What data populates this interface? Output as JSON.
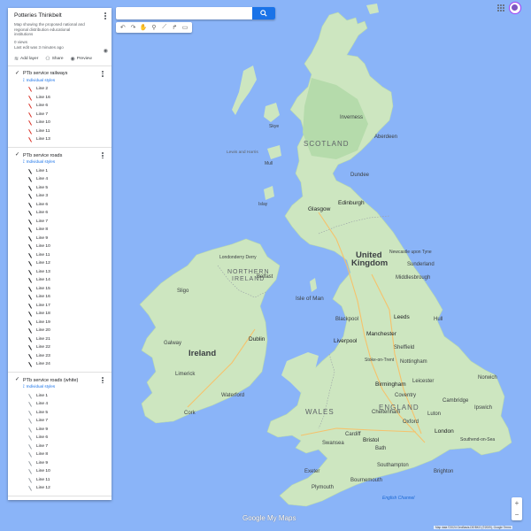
{
  "search": {
    "placeholder": "",
    "value": ""
  },
  "toolbar": {
    "icons": [
      "undo-icon",
      "redo-icon",
      "hand-icon",
      "marker-icon",
      "draw-line-icon",
      "directions-icon",
      "ruler-icon"
    ]
  },
  "panel": {
    "title": "Potteries Thinkbelt",
    "description": "Map showing the proposed national and regional distribution educational institutions",
    "views": "0 views",
    "last_edit": "Last edit was 3 minutes ago",
    "actions": {
      "add_layer": "Add layer",
      "share": "Share",
      "preview": "Preview"
    },
    "individual_styles": "Individual styles",
    "layers": [
      {
        "name": "PTb service railways",
        "color": "#d93025",
        "items": [
          "Line 2",
          "Line 16",
          "Line 6",
          "Line 7",
          "Line 10",
          "Line 11",
          "Line 13"
        ]
      },
      {
        "name": "PTb service roads",
        "color": "#202124",
        "items": [
          "Line 1",
          "Line 4",
          "Line 5",
          "Line 3",
          "Line 6",
          "Line 6",
          "Line 7",
          "Line 8",
          "Line 9",
          "Line 10",
          "Line 11",
          "Line 12",
          "Line 13",
          "Line 14",
          "Line 15",
          "Line 16",
          "Line 17",
          "Line 18",
          "Line 19",
          "Line 20",
          "Line 21",
          "Line 22",
          "Line 23",
          "Line 24"
        ]
      },
      {
        "name": "PTb service roads (white)",
        "color": "#9aa0a6",
        "items": [
          "Line 1",
          "Line 4",
          "Line 5",
          "Line 7",
          "Line 9",
          "Line 6",
          "Line 7",
          "Line 8",
          "Line 9",
          "Line 10",
          "Line 11",
          "Line 12"
        ]
      }
    ]
  },
  "map": {
    "countries": {
      "scotland": "SCOTLAND",
      "northern_ireland": "NORTHERN IRELAND",
      "england": "ENGLAND",
      "wales": "WALES"
    },
    "big_labels": {
      "uk_1": "United",
      "uk_2": "Kingdom",
      "ireland": "Ireland",
      "isle_of_man": "Isle of Man"
    },
    "cities": {
      "inverness": "Inverness",
      "aberdeen": "Aberdeen",
      "dundee": "Dundee",
      "edinburgh": "Edinburgh",
      "glasgow": "Glasgow",
      "belfast": "Belfast",
      "londonderry": "Londonderry Derry",
      "newcastle": "Newcastle upon Tyne",
      "sunderland": "Sunderland",
      "middlesbrough": "Middlesbrough",
      "leeds": "Leeds",
      "hull": "Hull",
      "manchester": "Manchester",
      "liverpool": "Liverpool",
      "blackpool": "Blackpool",
      "sheffield": "Sheffield",
      "nottingham": "Nottingham",
      "stoke": "Stoke-on-Trent",
      "birmingham": "Birmingham",
      "coventry": "Coventry",
      "leicester": "Leicester",
      "norwich": "Norwich",
      "cambridge": "Cambridge",
      "ipswich": "Ipswich",
      "luton": "Luton",
      "oxford": "Oxford",
      "london": "London",
      "cheltenham": "Cheltenham",
      "cardiff": "Cardiff",
      "swansea": "Swansea",
      "bristol": "Bristol",
      "bath": "Bath",
      "southend": "Southend-on-Sea",
      "brighton": "Brighton",
      "southampton": "Southampton",
      "exeter": "Exeter",
      "plymouth": "Plymouth",
      "bournemouth": "Bournemouth",
      "dublin": "Dublin",
      "galway": "Galway",
      "limerick": "Limerick",
      "cork": "Cork",
      "waterford": "Waterford",
      "sligo": "Sligo"
    },
    "islands": {
      "lewis": "Lewis and Harris",
      "skye": "Skye",
      "mull": "Mull",
      "islay": "Islay"
    },
    "sea": {
      "english_channel": "English Channel"
    }
  },
  "footer": {
    "google_logo": "Google My Maps",
    "attribution": "Map data ©2024 GeoBasis-DE/BKG (©2009), Google  Terms"
  },
  "zoom": {
    "in": "+",
    "out": "−"
  },
  "colors": {
    "water": "#8ab4f8",
    "land": "#cde6c0",
    "land_dark": "#a8d5a0",
    "accent": "#1a73e8",
    "railway": "#d93025"
  }
}
